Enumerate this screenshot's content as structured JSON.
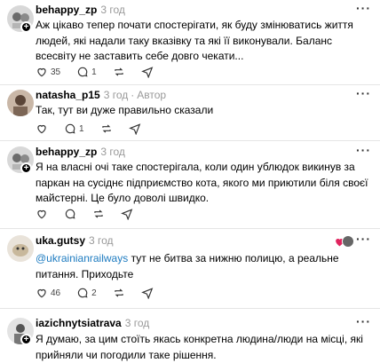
{
  "posts": [
    {
      "user": "behappy_zp",
      "time": "3 год",
      "text": "Аж цікаво тепер почати спостерігати, як буду змінюватись життя людей, які надали таку вказівку та які її виконували. Баланс всесвіту не заставить себе довго чекати...",
      "likes": "35",
      "replies": "1"
    },
    {
      "user": "natasha_p15",
      "time": "3 год",
      "dot": "·",
      "role": "Автор",
      "text": "Так, тут ви дуже правильно сказали",
      "replies": "1"
    },
    {
      "user": "behappy_zp",
      "time": "3 год",
      "text": "Я на власні очі таке спостерігала, коли один ублюдок викинув за паркан на сусіднє підприємство кота, якого ми приютили біля своєї майстерні. Це було доволі швидко."
    },
    {
      "user": "uka.gutsy",
      "time": "3 год",
      "mention": "@ukrainianrailways",
      "text": " тут не битва за нижню полицю, а реальне питання. Приходьте",
      "likes": "46",
      "replies": "2"
    },
    {
      "user": "iazichnytsiatrava",
      "time": "3 год",
      "text": "Я думаю, за цим стоїть якась конкретна людина/люди на місці, які прийняли чи погодили таке рішення."
    }
  ],
  "icons": {
    "like": "heart-icon",
    "reply": "comment-icon",
    "repost": "repost-icon",
    "share": "share-icon",
    "more": "more-icon",
    "follow": "plus-icon"
  },
  "more_glyph": "···",
  "plus_glyph": "+",
  "colors": {
    "mention": "#1d7bc0",
    "meta": "#999999",
    "reaction_heart": "#e0245e"
  }
}
